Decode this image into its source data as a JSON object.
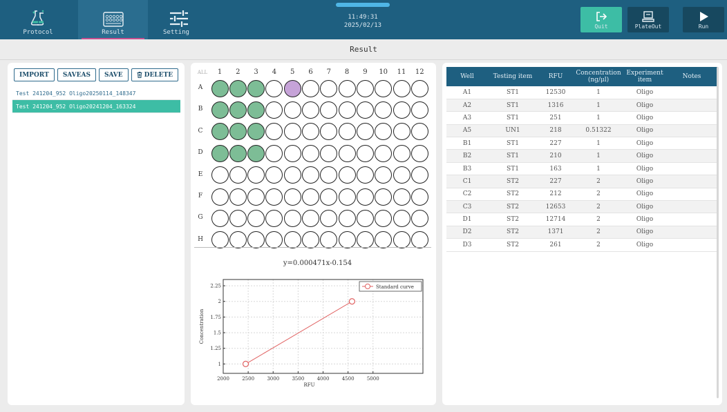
{
  "nav": {
    "protocol_label": "Protocol",
    "result_label": "Result",
    "setting_label": "Setting"
  },
  "clock": {
    "time": "11:49:31",
    "date": "2025/02/13"
  },
  "actions": {
    "quit_label": "Quit",
    "plateout_label": "PlateOut",
    "run_label": "Run"
  },
  "colors": {
    "topbar": "#1e5f80",
    "quit": "#3dbda5",
    "plateout": "#17485f",
    "run": "#17485f",
    "selected_row": "#3dbda5",
    "well_standard": "#7dbd96",
    "well_unknown": "#c6a3d8"
  },
  "page_title": "Result",
  "toolbar": {
    "import_label": "IMPORT",
    "saveas_label": "SAVEAS",
    "save_label": "SAVE",
    "delete_label": "DELETE"
  },
  "files": [
    {
      "name": "Test 241204_952 Oligo20250114_148347",
      "selected": false
    },
    {
      "name": "Test 241204_952 Oligo20241204_163324",
      "selected": true
    }
  ],
  "plate": {
    "all_label": "ALL",
    "columns": [
      "1",
      "2",
      "3",
      "4",
      "5",
      "6",
      "7",
      "8",
      "9",
      "10",
      "11",
      "12"
    ],
    "rows": [
      "A",
      "B",
      "C",
      "D",
      "E",
      "F",
      "G",
      "H"
    ],
    "filled": {
      "A1": "standard",
      "A2": "standard",
      "A3": "standard",
      "A5": "unknown",
      "B1": "standard",
      "B2": "standard",
      "B3": "standard",
      "C1": "standard",
      "C2": "standard",
      "C3": "standard",
      "D1": "standard",
      "D2": "standard",
      "D3": "standard"
    }
  },
  "chart_data": {
    "type": "line",
    "title": "y=0.000471x-0.154",
    "xlabel": "RFU",
    "ylabel": "Concentration",
    "xlim": [
      2000,
      6000
    ],
    "ylim": [
      0.85,
      2.35
    ],
    "xticks": [
      "2000",
      "2500",
      "3000",
      "3500",
      "4000",
      "4500",
      "5000"
    ],
    "yticks": [
      "1",
      "1.25",
      "1.5",
      "1.75",
      "2",
      "2.25"
    ],
    "grid": true,
    "legend_position": "top-right",
    "series": [
      {
        "name": "Standard curve",
        "color": "#e06060",
        "x": [
          2450,
          4580
        ],
        "y": [
          1,
          2
        ]
      }
    ]
  },
  "table": {
    "headers": [
      "Well",
      "Testing item",
      "RFU",
      "Concentration (ng/μl)",
      "Experiment item",
      "Notes"
    ],
    "rows": [
      [
        "A1",
        "ST1",
        "12530",
        "1",
        "Oligo",
        ""
      ],
      [
        "A2",
        "ST1",
        "1316",
        "1",
        "Oligo",
        ""
      ],
      [
        "A3",
        "ST1",
        "251",
        "1",
        "Oligo",
        ""
      ],
      [
        "A5",
        "UN1",
        "218",
        "0.51322",
        "Oligo",
        ""
      ],
      [
        "B1",
        "ST1",
        "227",
        "1",
        "Oligo",
        ""
      ],
      [
        "B2",
        "ST1",
        "210",
        "1",
        "Oligo",
        ""
      ],
      [
        "B3",
        "ST1",
        "163",
        "1",
        "Oligo",
        ""
      ],
      [
        "C1",
        "ST2",
        "227",
        "2",
        "Oligo",
        ""
      ],
      [
        "C2",
        "ST2",
        "212",
        "2",
        "Oligo",
        ""
      ],
      [
        "C3",
        "ST2",
        "12653",
        "2",
        "Oligo",
        ""
      ],
      [
        "D1",
        "ST2",
        "12714",
        "2",
        "Oligo",
        ""
      ],
      [
        "D2",
        "ST2",
        "1371",
        "2",
        "Oligo",
        ""
      ],
      [
        "D3",
        "ST2",
        "261",
        "2",
        "Oligo",
        ""
      ]
    ]
  }
}
